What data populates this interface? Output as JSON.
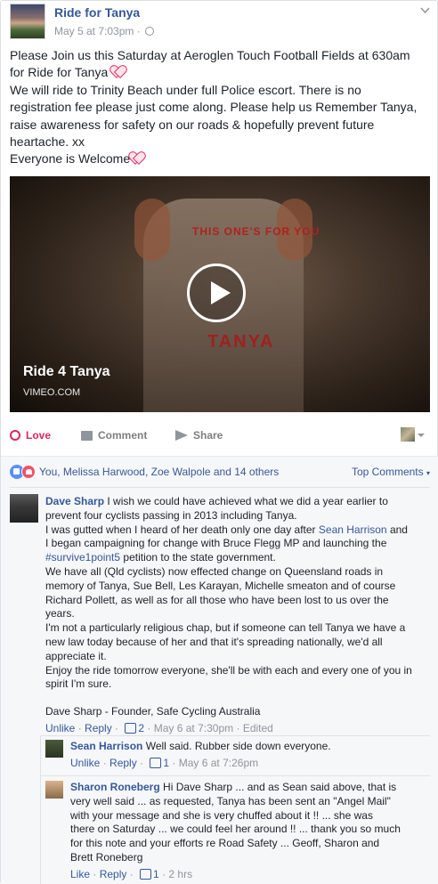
{
  "post": {
    "page_name": "Ride for Tanya",
    "timestamp": "May 5 at 7:03pm",
    "privacy_icon": "globe-icon",
    "options_icon": "chevron-down-icon",
    "text_lines": [
      "Please Join us this Saturday at Aeroglen Touch Football Fields at 630am",
      "for Ride for Tanya",
      "We will ride to Trinity Beach under full Police escort. There is no",
      "registration fee please just come along. Please help us Remember Tanya,",
      "raise awareness for safety on our roads & hopefully prevent future",
      "heartache. xx",
      "Everyone is Welcome"
    ]
  },
  "video": {
    "shirt_top_text": "THIS ONE'S FOR YOU",
    "shirt_big_text": "TANYA",
    "title": "Ride 4 Tanya",
    "source": "VIMEO.COM",
    "play_icon": "play-icon"
  },
  "actions": {
    "love": "Love",
    "comment": "Comment",
    "share": "Share"
  },
  "reactions": {
    "summary": "You, Melissa Harwood, Zoe Walpole and 14 others",
    "sort": "Top Comments"
  },
  "comments": {
    "dave": {
      "author": "Dave Sharp",
      "line1": "I wish we could have achieved what we did a year earlier to",
      "line2": "prevent four cyclists passing in 2013 including Tanya.",
      "line3a": "I was gutted when I heard of her death only one day after",
      "mention": "Sean Harrison",
      "line3b": "and",
      "line4": "I began campaigning for change with Bruce Flegg MP and launching the",
      "hashtag": "#survive1point5",
      "line5b": "petition to the state government.",
      "line6": "We have all (Qld cyclists) now effected change on Queensland roads in",
      "line7": "memory of Tanya, Sue Bell, Les Karayan, Michelle smeaton and of course",
      "line8": "Richard Pollett, as well as for all those who have been lost to us over the",
      "line9": "years.",
      "line10": "I'm not a particularly religious chap, but if someone can tell Tanya we have a",
      "line11": "new law today because of her and that it's spreading nationally, we'd all",
      "line12": "appreciate it.",
      "line13": "Enjoy the ride tomorrow everyone, she'll be with each and every one of you in",
      "line14": "spirit I'm sure.",
      "signature": "Dave Sharp - Founder, Safe Cycling Australia",
      "unlike": "Unlike",
      "reply": "Reply",
      "likes": "2",
      "time": "May 6 at 7:30pm",
      "edited": "Edited"
    },
    "sean": {
      "author": "Sean Harrison",
      "text": "Well said. Rubber side down everyone.",
      "unlike": "Unlike",
      "reply": "Reply",
      "likes": "1",
      "time": "May 6 at 7:26pm"
    },
    "sharon": {
      "author": "Sharon Roneberg",
      "line1": "Hi Dave Sharp ... and as Sean said above, that is",
      "line2": "very well said ... as requested, Tanya has been sent an \"Angel Mail\"",
      "line3": "with your message and she is very chuffed about it !! ... she was",
      "line4": "there on Saturday ... we could feel her around !! ... thank you so much",
      "line5": "for this note and your efforts re Road Safety ... Geoff, Sharon and",
      "line6": "Brett Roneberg",
      "like": "Like",
      "reply": "Reply",
      "likes": "1",
      "time": "2 hrs"
    }
  }
}
